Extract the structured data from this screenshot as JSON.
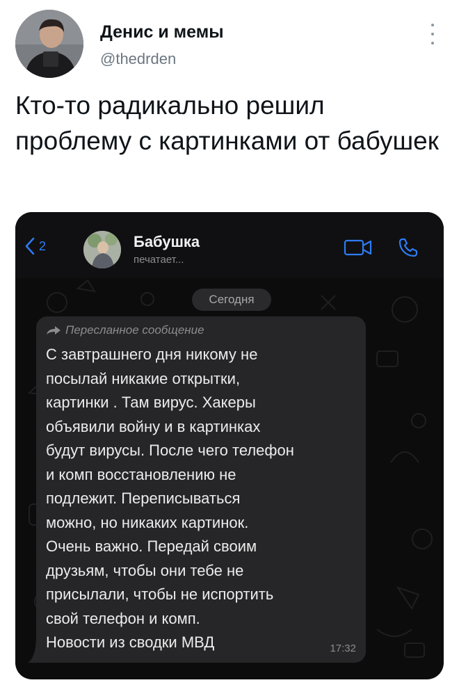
{
  "tweet": {
    "author_name": "Денис и мемы",
    "author_handle": "@thedrden",
    "text": "Кто-то радикально решил проблему с картинками от бабушек"
  },
  "chat": {
    "back_count": "2",
    "contact_name": "Бабушка",
    "contact_status": "печатает...",
    "date_label": "Сегодня",
    "message": {
      "forwarded_label": "Пересланное сообщение",
      "text": "С завтрашнего дня никому не\nпосылай никакие открытки,\nкартинки . Там вирус. Хакеры\nобъявили войну и в картинках\nбудут вирусы. После чего телефон\nи комп восстановлению не\nподлежит. Переписываться\nможно, но никаких картинок.\nОчень важно. Передай своим\nдрузьям, чтобы они тебе не\nприсылали, чтобы не испортить\nсвой телефон и комп.\nНовости из сводки МВД",
      "time": "17:32"
    },
    "colors": {
      "accent": "#2e7cf6",
      "background": "#0c0c0d",
      "bubble": "#262628"
    }
  }
}
